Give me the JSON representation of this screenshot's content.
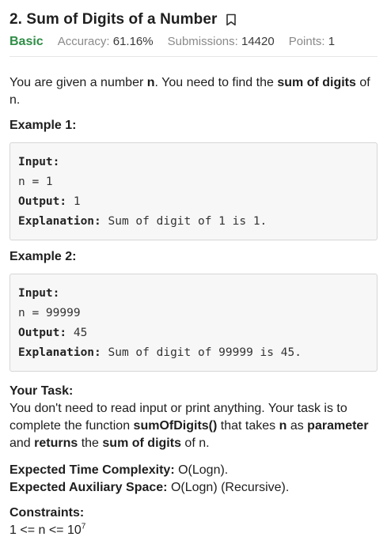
{
  "problem": {
    "title": "2. Sum of Digits of a Number",
    "difficulty": "Basic",
    "accuracy_label": "Accuracy:",
    "accuracy_value": "61.16%",
    "submissions_label": "Submissions:",
    "submissions_value": "14420",
    "points_label": "Points:",
    "points_value": "1"
  },
  "description": {
    "part1": "You are given a number ",
    "n_bold": "n",
    "part2": ". You need to find the ",
    "sum_bold": "sum of digits",
    "part3": " of n."
  },
  "examples": [
    {
      "heading": "Example 1:",
      "input_label": "Input:",
      "input_value": "n = 1",
      "output_label": "Output:",
      "output_value": " 1",
      "explanation_label": "Explanation:",
      "explanation_value": " Sum of digit of 1 is 1."
    },
    {
      "heading": "Example 2:",
      "input_label": "Input:",
      "input_value": "n = 99999",
      "output_label": "Output:",
      "output_value": " 45",
      "explanation_label": "Explanation:",
      "explanation_value": " Sum of digit of 99999 is 45."
    }
  ],
  "task": {
    "heading": "Your Task:",
    "t1": "You don't need to read input or print anything. Your task is to complete the function ",
    "fn_bold": "sumOfDigits()",
    "t2": " that takes ",
    "n_bold": "n",
    "t3": " as ",
    "param_bold": "parameter",
    "t4": " and ",
    "returns_bold": "returns",
    "t5": " the ",
    "sumdig_bold": "sum of digits",
    "t6": " of n."
  },
  "complexity": {
    "time_label": "Expected Time Complexity:",
    "time_value": " O(Logn).",
    "space_label": "Expected Auxiliary Space:",
    "space_value": " O(Logn) (Recursive)."
  },
  "constraints": {
    "heading": "Constraints:",
    "value": "1 <= n <= 10",
    "exponent": "7"
  }
}
